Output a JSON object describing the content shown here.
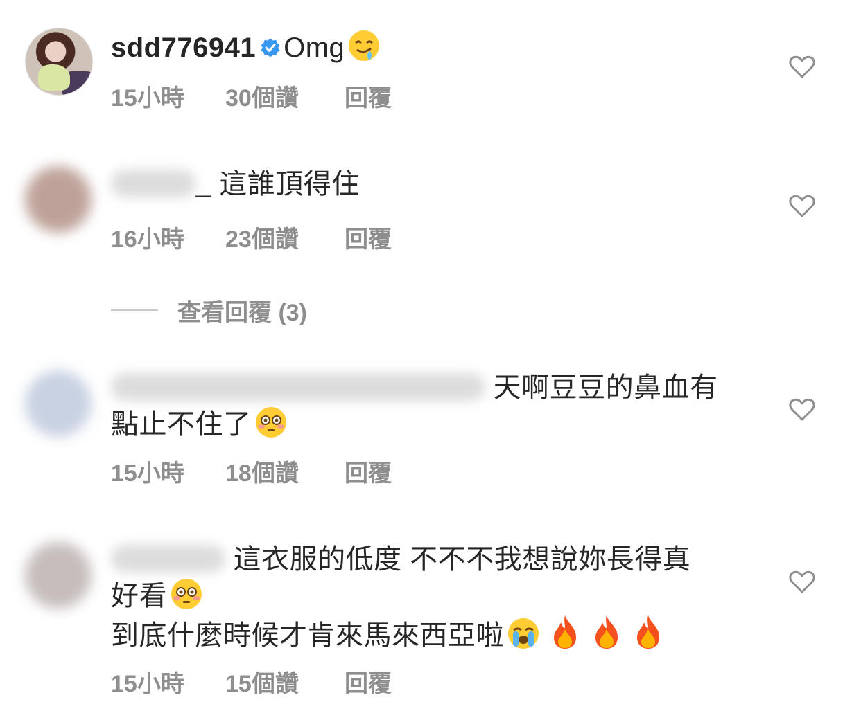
{
  "comments": [
    {
      "username": "sdd776941",
      "verified": true,
      "lines": [
        "Omg"
      ],
      "time": "15小時",
      "likes": "30個讚",
      "reply": "回覆"
    },
    {
      "username_suffix": "_",
      "lines": [
        "這誰頂得住"
      ],
      "time": "16小時",
      "likes": "23個讚",
      "reply": "回覆"
    },
    {
      "lines": [
        "天啊豆豆的鼻血有",
        "點止不住了"
      ],
      "time": "15小時",
      "likes": "18個讚",
      "reply": "回覆"
    },
    {
      "lines": [
        "這衣服的低度 不不不我想說妳長得真",
        "好看",
        "到底什麼時候才肯來馬來西亞啦"
      ],
      "time": "15小時",
      "likes": "15個讚",
      "reply": "回覆"
    }
  ],
  "view_replies": {
    "label": "查看回覆 (3)"
  },
  "icons": {
    "like": "heart-outline-icon",
    "verified": "verified-badge-icon"
  },
  "colors": {
    "text": "#262626",
    "meta": "#8e8e8e",
    "verified": "#3897f0",
    "heart": "#8e8e8e"
  }
}
